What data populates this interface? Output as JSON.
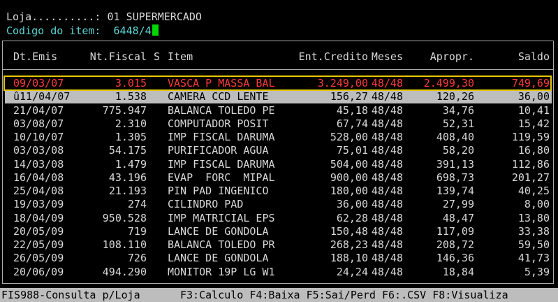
{
  "header": {
    "loja_label": "Loja..........: ",
    "loja_value": "01 SUPERMERCADO",
    "item_label": "Codigo do item:  ",
    "item_value": "6448/4"
  },
  "columns": {
    "date": "Dt.Emis",
    "nf": "Nt.Fiscal",
    "s": "S",
    "item": "Item",
    "ent": "Ent.Credito",
    "mes": "Meses",
    "apr": "Apropr.",
    "sal": "Saldo"
  },
  "rows": [
    {
      "date": "09/03/07",
      "nf": "3.015",
      "item": "VASCA P MASSA BAL",
      "ent": "3.249,00",
      "mes": "48/48",
      "apr": "2.499,30",
      "sal": "749,69"
    },
    {
      "date": "û11/04/07",
      "nf": "1.538",
      "item": "CAMERA CCD LENTE",
      "ent": "156,27",
      "mes": "48/48",
      "apr": "120,26",
      "sal": "36,00"
    },
    {
      "date": "21/04/07",
      "nf": "775.947",
      "item": "BALANCA TOLEDO PE",
      "ent": "45,18",
      "mes": "48/48",
      "apr": "34,76",
      "sal": "10,41"
    },
    {
      "date": "03/08/07",
      "nf": "2.310",
      "item": "COMPUTADOR POSIT",
      "ent": "67,74",
      "mes": "48/48",
      "apr": "52,31",
      "sal": "15,42"
    },
    {
      "date": "10/10/07",
      "nf": "1.305",
      "item": "IMP FISCAL DARUMA",
      "ent": "528,00",
      "mes": "48/48",
      "apr": "408,40",
      "sal": "119,59"
    },
    {
      "date": "03/03/08",
      "nf": "54.175",
      "item": "PURIFICADOR AGUA",
      "ent": "75,01",
      "mes": "48/48",
      "apr": "58,20",
      "sal": "16,80"
    },
    {
      "date": "14/03/08",
      "nf": "1.479",
      "item": "IMP FISCAL DARUMA",
      "ent": "504,00",
      "mes": "48/48",
      "apr": "391,13",
      "sal": "112,86"
    },
    {
      "date": "16/04/08",
      "nf": "43.196",
      "item": "EVAP  FORC  MIPAL",
      "ent": "900,00",
      "mes": "48/48",
      "apr": "698,73",
      "sal": "201,27"
    },
    {
      "date": "25/04/08",
      "nf": "21.193",
      "item": "PIN PAD INGENICO",
      "ent": "180,00",
      "mes": "48/48",
      "apr": "139,74",
      "sal": "40,25"
    },
    {
      "date": "19/03/09",
      "nf": "274",
      "item": "CILINDRO PAD",
      "ent": "36,00",
      "mes": "48/48",
      "apr": "27,99",
      "sal": "8,00"
    },
    {
      "date": "18/04/09",
      "nf": "950.528",
      "item": "IMP MATRICIAL EPS",
      "ent": "62,28",
      "mes": "48/48",
      "apr": "48,47",
      "sal": "13,80"
    },
    {
      "date": "20/05/09",
      "nf": "719",
      "item": "LANCE DE GONDOLA",
      "ent": "150,48",
      "mes": "48/48",
      "apr": "117,09",
      "sal": "33,38"
    },
    {
      "date": "22/05/09",
      "nf": "108.110",
      "item": "BALANCA TOLEDO PR",
      "ent": "268,23",
      "mes": "48/48",
      "apr": "208,72",
      "sal": "59,50"
    },
    {
      "date": "26/05/09",
      "nf": "726",
      "item": "LANCE DE GONDOLA",
      "ent": "188,10",
      "mes": "48/48",
      "apr": "146,36",
      "sal": "41,73"
    },
    {
      "date": "20/06/09",
      "nf": "494.290",
      "item": "MONITOR 19P LG W1",
      "ent": "24,24",
      "mes": "48/48",
      "apr": "18,84",
      "sal": "5,39"
    }
  ],
  "statusbar": {
    "program": "FIS988-Consulta p/Loja",
    "keys": "F3:Calculo F4:Baixa F5:Sai/Perd F6:.CSV F8:Visualiza"
  },
  "colors": {
    "selected_text": "#ff3b3b",
    "selected_border": "#e8c800",
    "highlight_bg": "#bdbdbd",
    "cursor": "#00d800",
    "label_cyan": "#5fd7d7"
  }
}
